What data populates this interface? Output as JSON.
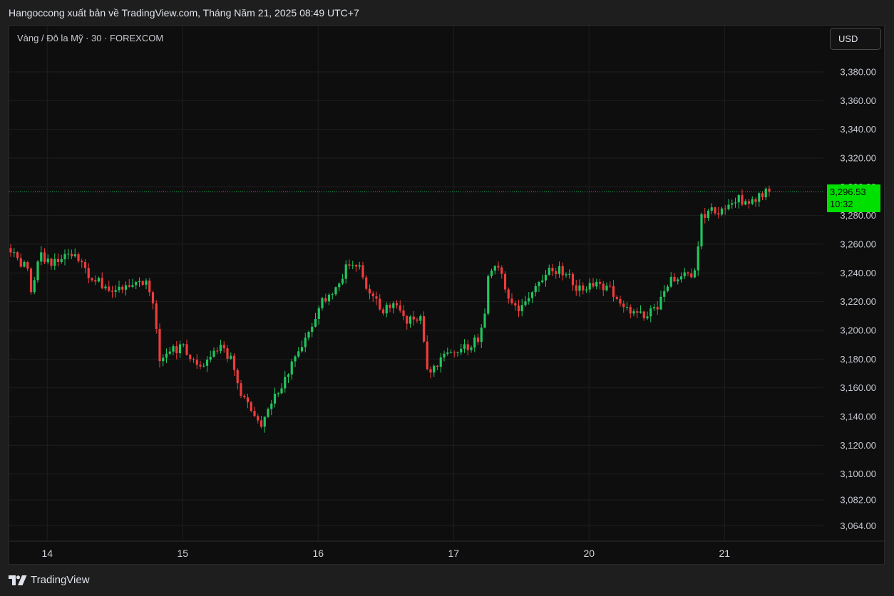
{
  "header": {
    "publisher_line": "Hangoccong xuất bản về TradingView.com, Tháng Năm 21, 2025 08:49 UTC+7"
  },
  "toolbar": {
    "symbol_label": "Vàng / Đô la Mỹ · 30 · FOREXCOM",
    "currency_label": "USD"
  },
  "last_price": {
    "value": 3296.53,
    "label": "3,296.53",
    "countdown": "10:32"
  },
  "footer": {
    "brand": "TradingView"
  },
  "colors": {
    "up": "#22c55e",
    "down": "#ef3c3c",
    "badge": "#00e000",
    "background": "#0e0e0e",
    "grid": "#1f1f1f"
  },
  "icons": {
    "brand_logo": "tradingview-logo-icon"
  },
  "chart_data": {
    "type": "candlestick",
    "title": "",
    "xlabel": "",
    "ylabel": "",
    "ylim": [
      3064,
      3390
    ],
    "grid": true,
    "x_tick_labels": [
      {
        "label": "14",
        "index": 7
      },
      {
        "label": "15",
        "index": 47
      },
      {
        "label": "16",
        "index": 87
      },
      {
        "label": "17",
        "index": 127
      },
      {
        "label": "20",
        "index": 167
      },
      {
        "label": "21",
        "index": 207
      }
    ],
    "y_tick_labels": [
      {
        "label": "3,380.00",
        "value": 3380
      },
      {
        "label": "3,360.00",
        "value": 3360
      },
      {
        "label": "3,340.00",
        "value": 3340
      },
      {
        "label": "3,320.00",
        "value": 3320
      },
      {
        "label": "3,300.00",
        "value": 3300
      },
      {
        "label": "3,280.00",
        "value": 3280
      },
      {
        "label": "3,260.00",
        "value": 3260
      },
      {
        "label": "3,240.00",
        "value": 3240
      },
      {
        "label": "3,220.00",
        "value": 3220
      },
      {
        "label": "3,200.00",
        "value": 3200
      },
      {
        "label": "3,180.00",
        "value": 3180
      },
      {
        "label": "3,160.00",
        "value": 3160
      },
      {
        "label": "3,140.00",
        "value": 3140
      },
      {
        "label": "3,120.00",
        "value": 3120
      },
      {
        "label": "3,100.00",
        "value": 3100
      },
      {
        "label": "3,082.00",
        "value": 3082
      },
      {
        "label": "3,064.00",
        "value": 3064
      }
    ],
    "anchors": [
      {
        "index": 0,
        "price": 3255
      },
      {
        "index": 5,
        "price": 3243
      },
      {
        "index": 6,
        "price": 3228
      },
      {
        "index": 9,
        "price": 3253
      },
      {
        "index": 12,
        "price": 3245
      },
      {
        "index": 18,
        "price": 3253
      },
      {
        "index": 22,
        "price": 3242
      },
      {
        "index": 30,
        "price": 3225
      },
      {
        "index": 37,
        "price": 3232
      },
      {
        "index": 40,
        "price": 3235
      },
      {
        "index": 42,
        "price": 3220
      },
      {
        "index": 44,
        "price": 3180
      },
      {
        "index": 47,
        "price": 3185
      },
      {
        "index": 51,
        "price": 3190
      },
      {
        "index": 55,
        "price": 3175
      },
      {
        "index": 62,
        "price": 3187
      },
      {
        "index": 65,
        "price": 3180
      },
      {
        "index": 68,
        "price": 3155
      },
      {
        "index": 72,
        "price": 3142
      },
      {
        "index": 74,
        "price": 3132
      },
      {
        "index": 76,
        "price": 3148
      },
      {
        "index": 80,
        "price": 3160
      },
      {
        "index": 85,
        "price": 3185
      },
      {
        "index": 88,
        "price": 3200
      },
      {
        "index": 92,
        "price": 3220
      },
      {
        "index": 96,
        "price": 3228
      },
      {
        "index": 100,
        "price": 3248
      },
      {
        "index": 103,
        "price": 3245
      },
      {
        "index": 106,
        "price": 3225
      },
      {
        "index": 110,
        "price": 3213
      },
      {
        "index": 114,
        "price": 3220
      },
      {
        "index": 117,
        "price": 3208
      },
      {
        "index": 121,
        "price": 3210
      },
      {
        "index": 123,
        "price": 3170
      },
      {
        "index": 127,
        "price": 3180
      },
      {
        "index": 134,
        "price": 3187
      },
      {
        "index": 138,
        "price": 3195
      },
      {
        "index": 140,
        "price": 3210
      },
      {
        "index": 141,
        "price": 3235
      },
      {
        "index": 144,
        "price": 3245
      },
      {
        "index": 147,
        "price": 3225
      },
      {
        "index": 150,
        "price": 3215
      },
      {
        "index": 156,
        "price": 3232
      },
      {
        "index": 160,
        "price": 3243
      },
      {
        "index": 164,
        "price": 3240
      },
      {
        "index": 168,
        "price": 3228
      },
      {
        "index": 172,
        "price": 3232
      },
      {
        "index": 176,
        "price": 3230
      },
      {
        "index": 180,
        "price": 3220
      },
      {
        "index": 184,
        "price": 3210
      },
      {
        "index": 190,
        "price": 3213
      },
      {
        "index": 195,
        "price": 3235
      },
      {
        "index": 202,
        "price": 3240
      },
      {
        "index": 203,
        "price": 3260
      },
      {
        "index": 204,
        "price": 3280
      },
      {
        "index": 210,
        "price": 3285
      },
      {
        "index": 214,
        "price": 3292
      },
      {
        "index": 218,
        "price": 3290
      },
      {
        "index": 224,
        "price": 3296.53
      }
    ]
  }
}
